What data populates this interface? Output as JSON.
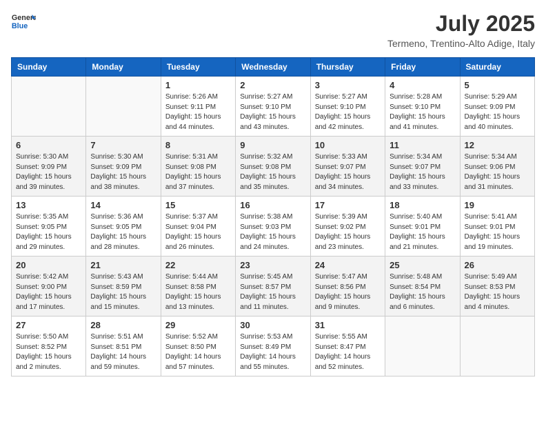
{
  "logo": {
    "line1": "General",
    "line2": "Blue"
  },
  "title": "July 2025",
  "subtitle": "Termeno, Trentino-Alto Adige, Italy",
  "days_header": [
    "Sunday",
    "Monday",
    "Tuesday",
    "Wednesday",
    "Thursday",
    "Friday",
    "Saturday"
  ],
  "weeks": [
    [
      {
        "day": "",
        "info": ""
      },
      {
        "day": "",
        "info": ""
      },
      {
        "day": "1",
        "info": "Sunrise: 5:26 AM\nSunset: 9:11 PM\nDaylight: 15 hours\nand 44 minutes."
      },
      {
        "day": "2",
        "info": "Sunrise: 5:27 AM\nSunset: 9:10 PM\nDaylight: 15 hours\nand 43 minutes."
      },
      {
        "day": "3",
        "info": "Sunrise: 5:27 AM\nSunset: 9:10 PM\nDaylight: 15 hours\nand 42 minutes."
      },
      {
        "day": "4",
        "info": "Sunrise: 5:28 AM\nSunset: 9:10 PM\nDaylight: 15 hours\nand 41 minutes."
      },
      {
        "day": "5",
        "info": "Sunrise: 5:29 AM\nSunset: 9:09 PM\nDaylight: 15 hours\nand 40 minutes."
      }
    ],
    [
      {
        "day": "6",
        "info": "Sunrise: 5:30 AM\nSunset: 9:09 PM\nDaylight: 15 hours\nand 39 minutes."
      },
      {
        "day": "7",
        "info": "Sunrise: 5:30 AM\nSunset: 9:09 PM\nDaylight: 15 hours\nand 38 minutes."
      },
      {
        "day": "8",
        "info": "Sunrise: 5:31 AM\nSunset: 9:08 PM\nDaylight: 15 hours\nand 37 minutes."
      },
      {
        "day": "9",
        "info": "Sunrise: 5:32 AM\nSunset: 9:08 PM\nDaylight: 15 hours\nand 35 minutes."
      },
      {
        "day": "10",
        "info": "Sunrise: 5:33 AM\nSunset: 9:07 PM\nDaylight: 15 hours\nand 34 minutes."
      },
      {
        "day": "11",
        "info": "Sunrise: 5:34 AM\nSunset: 9:07 PM\nDaylight: 15 hours\nand 33 minutes."
      },
      {
        "day": "12",
        "info": "Sunrise: 5:34 AM\nSunset: 9:06 PM\nDaylight: 15 hours\nand 31 minutes."
      }
    ],
    [
      {
        "day": "13",
        "info": "Sunrise: 5:35 AM\nSunset: 9:05 PM\nDaylight: 15 hours\nand 29 minutes."
      },
      {
        "day": "14",
        "info": "Sunrise: 5:36 AM\nSunset: 9:05 PM\nDaylight: 15 hours\nand 28 minutes."
      },
      {
        "day": "15",
        "info": "Sunrise: 5:37 AM\nSunset: 9:04 PM\nDaylight: 15 hours\nand 26 minutes."
      },
      {
        "day": "16",
        "info": "Sunrise: 5:38 AM\nSunset: 9:03 PM\nDaylight: 15 hours\nand 24 minutes."
      },
      {
        "day": "17",
        "info": "Sunrise: 5:39 AM\nSunset: 9:02 PM\nDaylight: 15 hours\nand 23 minutes."
      },
      {
        "day": "18",
        "info": "Sunrise: 5:40 AM\nSunset: 9:01 PM\nDaylight: 15 hours\nand 21 minutes."
      },
      {
        "day": "19",
        "info": "Sunrise: 5:41 AM\nSunset: 9:01 PM\nDaylight: 15 hours\nand 19 minutes."
      }
    ],
    [
      {
        "day": "20",
        "info": "Sunrise: 5:42 AM\nSunset: 9:00 PM\nDaylight: 15 hours\nand 17 minutes."
      },
      {
        "day": "21",
        "info": "Sunrise: 5:43 AM\nSunset: 8:59 PM\nDaylight: 15 hours\nand 15 minutes."
      },
      {
        "day": "22",
        "info": "Sunrise: 5:44 AM\nSunset: 8:58 PM\nDaylight: 15 hours\nand 13 minutes."
      },
      {
        "day": "23",
        "info": "Sunrise: 5:45 AM\nSunset: 8:57 PM\nDaylight: 15 hours\nand 11 minutes."
      },
      {
        "day": "24",
        "info": "Sunrise: 5:47 AM\nSunset: 8:56 PM\nDaylight: 15 hours\nand 9 minutes."
      },
      {
        "day": "25",
        "info": "Sunrise: 5:48 AM\nSunset: 8:54 PM\nDaylight: 15 hours\nand 6 minutes."
      },
      {
        "day": "26",
        "info": "Sunrise: 5:49 AM\nSunset: 8:53 PM\nDaylight: 15 hours\nand 4 minutes."
      }
    ],
    [
      {
        "day": "27",
        "info": "Sunrise: 5:50 AM\nSunset: 8:52 PM\nDaylight: 15 hours\nand 2 minutes."
      },
      {
        "day": "28",
        "info": "Sunrise: 5:51 AM\nSunset: 8:51 PM\nDaylight: 14 hours\nand 59 minutes."
      },
      {
        "day": "29",
        "info": "Sunrise: 5:52 AM\nSunset: 8:50 PM\nDaylight: 14 hours\nand 57 minutes."
      },
      {
        "day": "30",
        "info": "Sunrise: 5:53 AM\nSunset: 8:49 PM\nDaylight: 14 hours\nand 55 minutes."
      },
      {
        "day": "31",
        "info": "Sunrise: 5:55 AM\nSunset: 8:47 PM\nDaylight: 14 hours\nand 52 minutes."
      },
      {
        "day": "",
        "info": ""
      },
      {
        "day": "",
        "info": ""
      }
    ]
  ]
}
